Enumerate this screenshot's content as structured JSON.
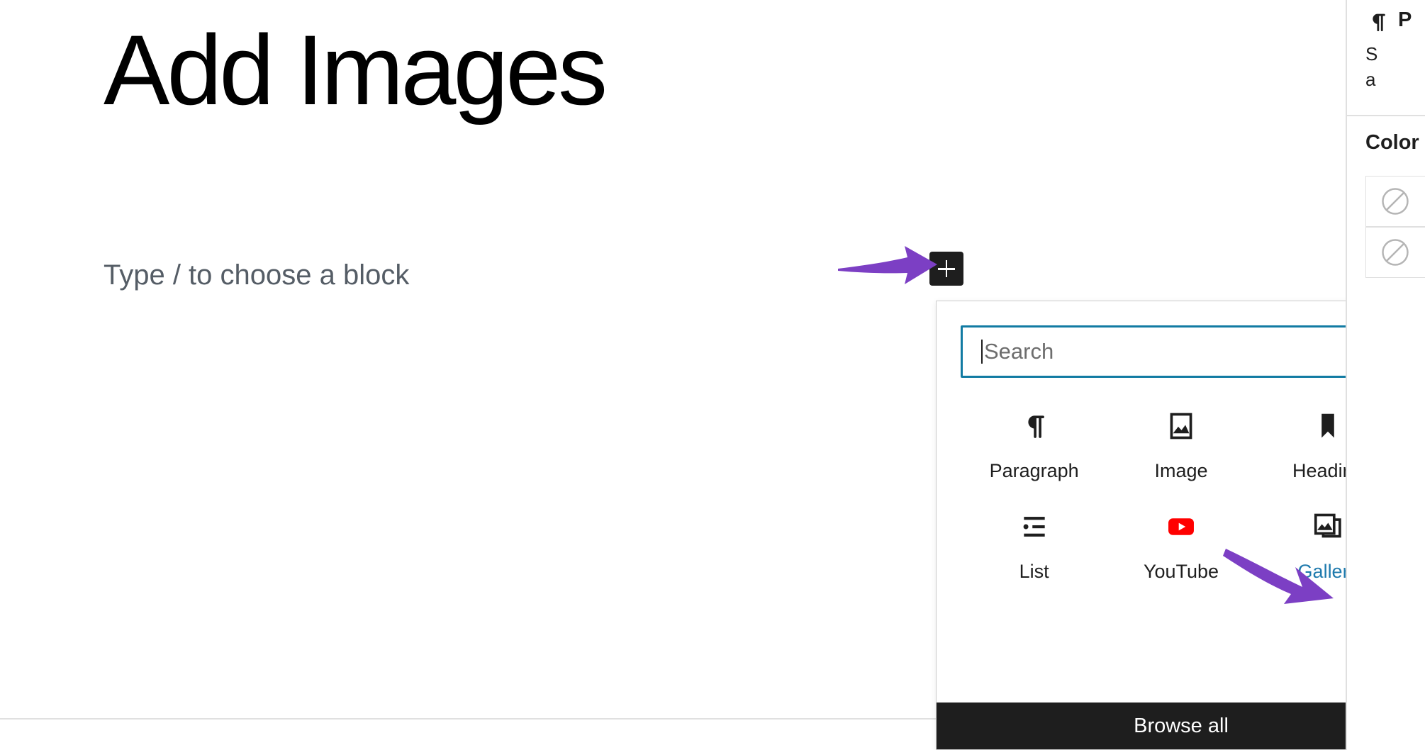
{
  "editor": {
    "post_title": "Add Images",
    "paragraph_placeholder": "Type / to choose a block",
    "inserter_button_label": "Add block",
    "inserter_icon": "plus-icon"
  },
  "annotations": [
    {
      "name": "arrow-to-inserter",
      "color": "#7c3fc4",
      "points_to": "block-inserter-button"
    },
    {
      "name": "arrow-to-gallery",
      "color": "#7c3fc4",
      "points_to": "block-type-gallery"
    }
  ],
  "inserter": {
    "search": {
      "placeholder": "Search",
      "value": "",
      "icon": "search-icon",
      "focused": true,
      "focus_border_color": "#127ba3"
    },
    "blocks": [
      {
        "label": "Paragraph",
        "icon": "paragraph-icon",
        "highlighted": false
      },
      {
        "label": "Image",
        "icon": "image-icon",
        "highlighted": false
      },
      {
        "label": "Heading",
        "icon": "heading-icon",
        "highlighted": false
      },
      {
        "label": "List",
        "icon": "list-icon",
        "highlighted": false
      },
      {
        "label": "YouTube",
        "icon": "youtube-icon",
        "highlighted": false
      },
      {
        "label": "Gallery",
        "icon": "gallery-icon",
        "highlighted": true
      }
    ],
    "browse_all_label": "Browse all",
    "browse_all_bg": "#1e1e1e",
    "highlight_color": "#1e7aad"
  },
  "sidebar": {
    "block_card": {
      "icon": "paragraph-icon",
      "title": "P",
      "description_line_1": "S",
      "description_line_2": "a"
    },
    "color_panel": {
      "title": "Color",
      "swatches": [
        {
          "name": "text-color-swatch",
          "value": "none",
          "icon": "no-color-icon"
        },
        {
          "name": "background-color-swatch",
          "value": "none",
          "icon": "no-color-icon"
        }
      ]
    }
  }
}
